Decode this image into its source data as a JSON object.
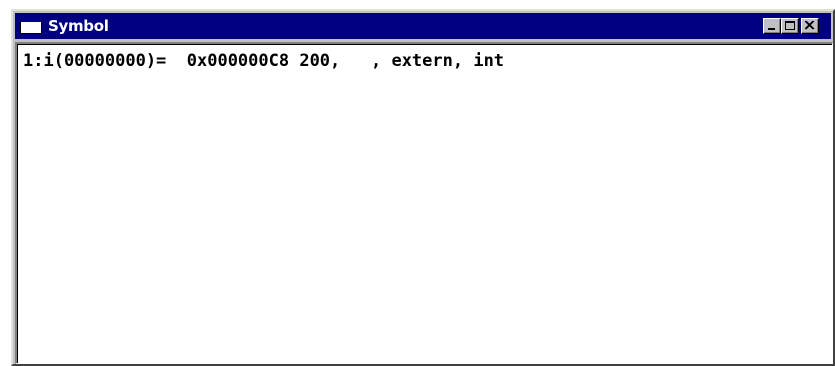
{
  "window": {
    "title": "Symbol",
    "controls": {
      "minimize": "minimize",
      "maximize": "maximize",
      "close": "close"
    }
  },
  "symbols": [
    "1:i(00000000)=  0x000000C8 200,   , extern, int"
  ],
  "colors": {
    "titlebar": "#000080",
    "title_text": "#ffffff",
    "content_bg": "#ffffff",
    "chrome": "#c0c0c0"
  },
  "icons": {
    "system": "window-icon",
    "minimize": "minimize-icon",
    "maximize": "maximize-icon",
    "close": "close-icon"
  }
}
